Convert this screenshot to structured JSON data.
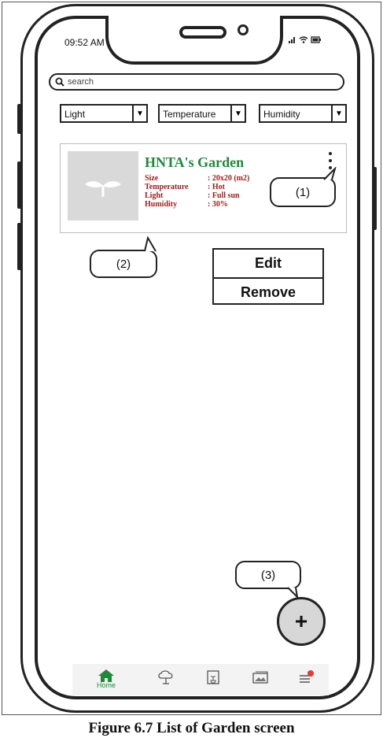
{
  "status_bar": {
    "time": "09:52 AM",
    "icons": "..ıl ☼ ▭"
  },
  "search": {
    "placeholder": "search"
  },
  "filters": [
    {
      "label": "Light"
    },
    {
      "label": "Temperature"
    },
    {
      "label": "Humidity"
    }
  ],
  "garden_card": {
    "title": "HNTA's Garden",
    "details": [
      {
        "key": "Size",
        "value": ": 20x20 (m2)"
      },
      {
        "key": "Temperature",
        "value": ": Hot"
      },
      {
        "key": "Light",
        "value": ": Full sun"
      },
      {
        "key": "Humidity",
        "value": ": 30%"
      }
    ]
  },
  "context_menu": {
    "edit": "Edit",
    "remove": "Remove"
  },
  "callouts": {
    "c1": "(1)",
    "c2": "(2)",
    "c3": "(3)"
  },
  "fab": {
    "label": "+"
  },
  "nav": {
    "home_label": "Home"
  },
  "caption": "Figure 6.7 List of Garden screen",
  "colors": {
    "title_green": "#1b8a3a",
    "detail_red": "#9c1b1b",
    "fab_gray": "#d7d7d7"
  }
}
